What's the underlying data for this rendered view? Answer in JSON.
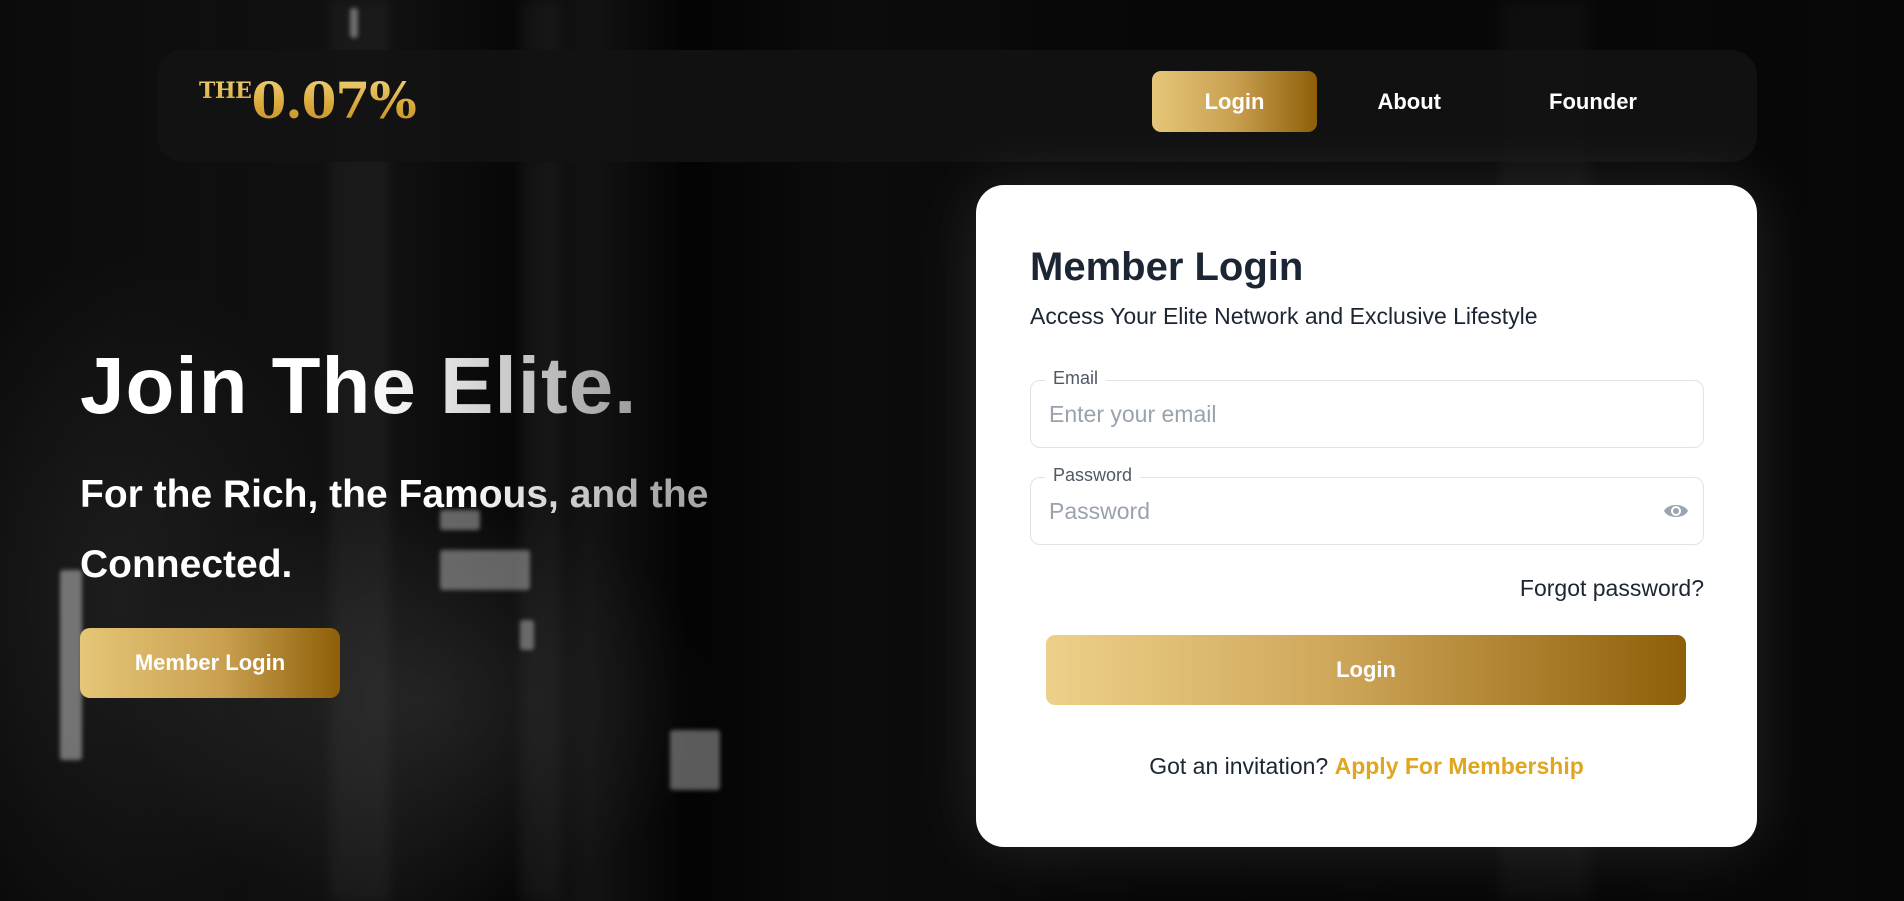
{
  "logo": {
    "prefix": "THE",
    "main": "0.07%"
  },
  "nav": {
    "items": [
      {
        "label": "Login"
      },
      {
        "label": "About"
      },
      {
        "label": "Founder"
      }
    ]
  },
  "hero": {
    "title": "Join The Elite.",
    "subtitle": "For the Rich, the Famous, and the Connected.",
    "button_label": "Member Login"
  },
  "login_card": {
    "title": "Member Login",
    "subtitle": "Access Your Elite Network and Exclusive Lifestyle",
    "email": {
      "label": "Email",
      "placeholder": "Enter your email",
      "value": ""
    },
    "password": {
      "label": "Password",
      "placeholder": "Password",
      "value": "",
      "icon": "eye-icon"
    },
    "forgot_label": "Forgot password?",
    "submit_label": "Login",
    "invite_text": "Got an invitation?",
    "invite_link": "Apply For Membership"
  },
  "colors": {
    "gold_light": "#e6c678",
    "gold_dark": "#8e5f08",
    "link_gold": "#e0a61f",
    "text_dark": "#1c2533"
  }
}
